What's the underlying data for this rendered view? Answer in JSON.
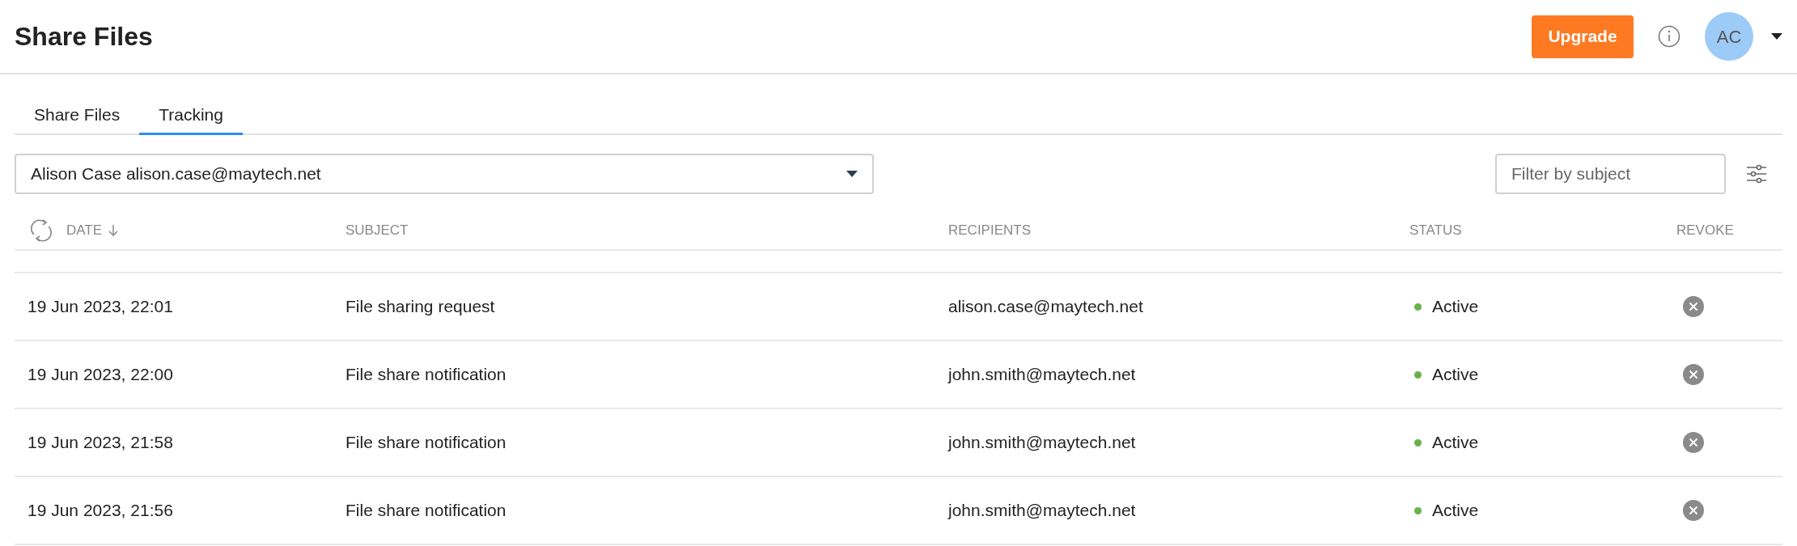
{
  "header": {
    "title": "Share Files",
    "upgrade_button": "Upgrade",
    "avatar": "AC"
  },
  "tabs": [
    {
      "label": "Share Files",
      "selected": false
    },
    {
      "label": "Tracking",
      "selected": true
    }
  ],
  "account_select": {
    "value": "Alison Case alison.case@maytech.net"
  },
  "filter": {
    "placeholder": "Filter by subject"
  },
  "table": {
    "columns": [
      {
        "label": "DATE",
        "sorted": true
      },
      {
        "label": "SUBJECT"
      },
      {
        "label": "RECIPIENTS"
      },
      {
        "label": "STATUS"
      },
      {
        "label": "REVOKE"
      }
    ],
    "rows": [
      {
        "date": "19 Jun 2023, 22:01",
        "subject": "File sharing request",
        "recipients": "alison.case@maytech.net",
        "status": "Active"
      },
      {
        "date": "19 Jun 2023, 22:00",
        "subject": "File share notification",
        "recipients": "john.smith@maytech.net",
        "status": "Active"
      },
      {
        "date": "19 Jun 2023, 21:58",
        "subject": "File share notification",
        "recipients": "john.smith@maytech.net",
        "status": "Active"
      },
      {
        "date": "19 Jun 2023, 21:56",
        "subject": "File share notification",
        "recipients": "john.smith@maytech.net",
        "status": "Active"
      }
    ]
  }
}
